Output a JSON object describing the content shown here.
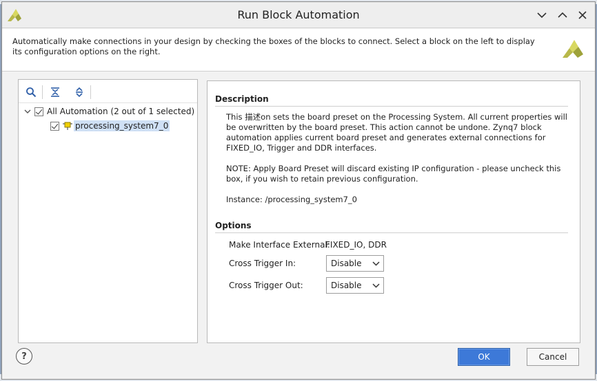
{
  "window": {
    "title": "Run Block Automation"
  },
  "info": {
    "text": "Automatically make connections in your design by checking the boxes of the blocks to connect. Select a block on the left to display its configuration options on the right."
  },
  "tree": {
    "root_label": "All Automation (2 out of 1 selected)",
    "root_checked": true,
    "child_label": "processing_system7_0",
    "child_checked": true
  },
  "description": {
    "title": "Description",
    "para1": "This 描述on sets the board preset on the Processing System. All current properties will be overwritten by the board preset. This action cannot be undone. Zynq7 block automation applies current board preset and generates external connections for FIXED_IO, Trigger and DDR interfaces.",
    "para2": "NOTE: Apply Board Preset will discard existing IP configuration - please uncheck this box, if you wish to retain previous configuration.",
    "instance": "Instance: /processing_system7_0"
  },
  "options": {
    "title": "Options",
    "make_external_label": "Make Interface External:",
    "make_external_value": "FIXED_IO, DDR",
    "cross_trigger_in_label": "Cross Trigger In:",
    "cross_trigger_in_value": "Disable",
    "cross_trigger_out_label": "Cross Trigger Out:",
    "cross_trigger_out_value": "Disable"
  },
  "buttons": {
    "help": "?",
    "ok": "OK",
    "cancel": "Cancel"
  },
  "colors": {
    "accent": "#3d79d8",
    "selection": "#cfe0f5",
    "logo": "#c8c84a"
  }
}
